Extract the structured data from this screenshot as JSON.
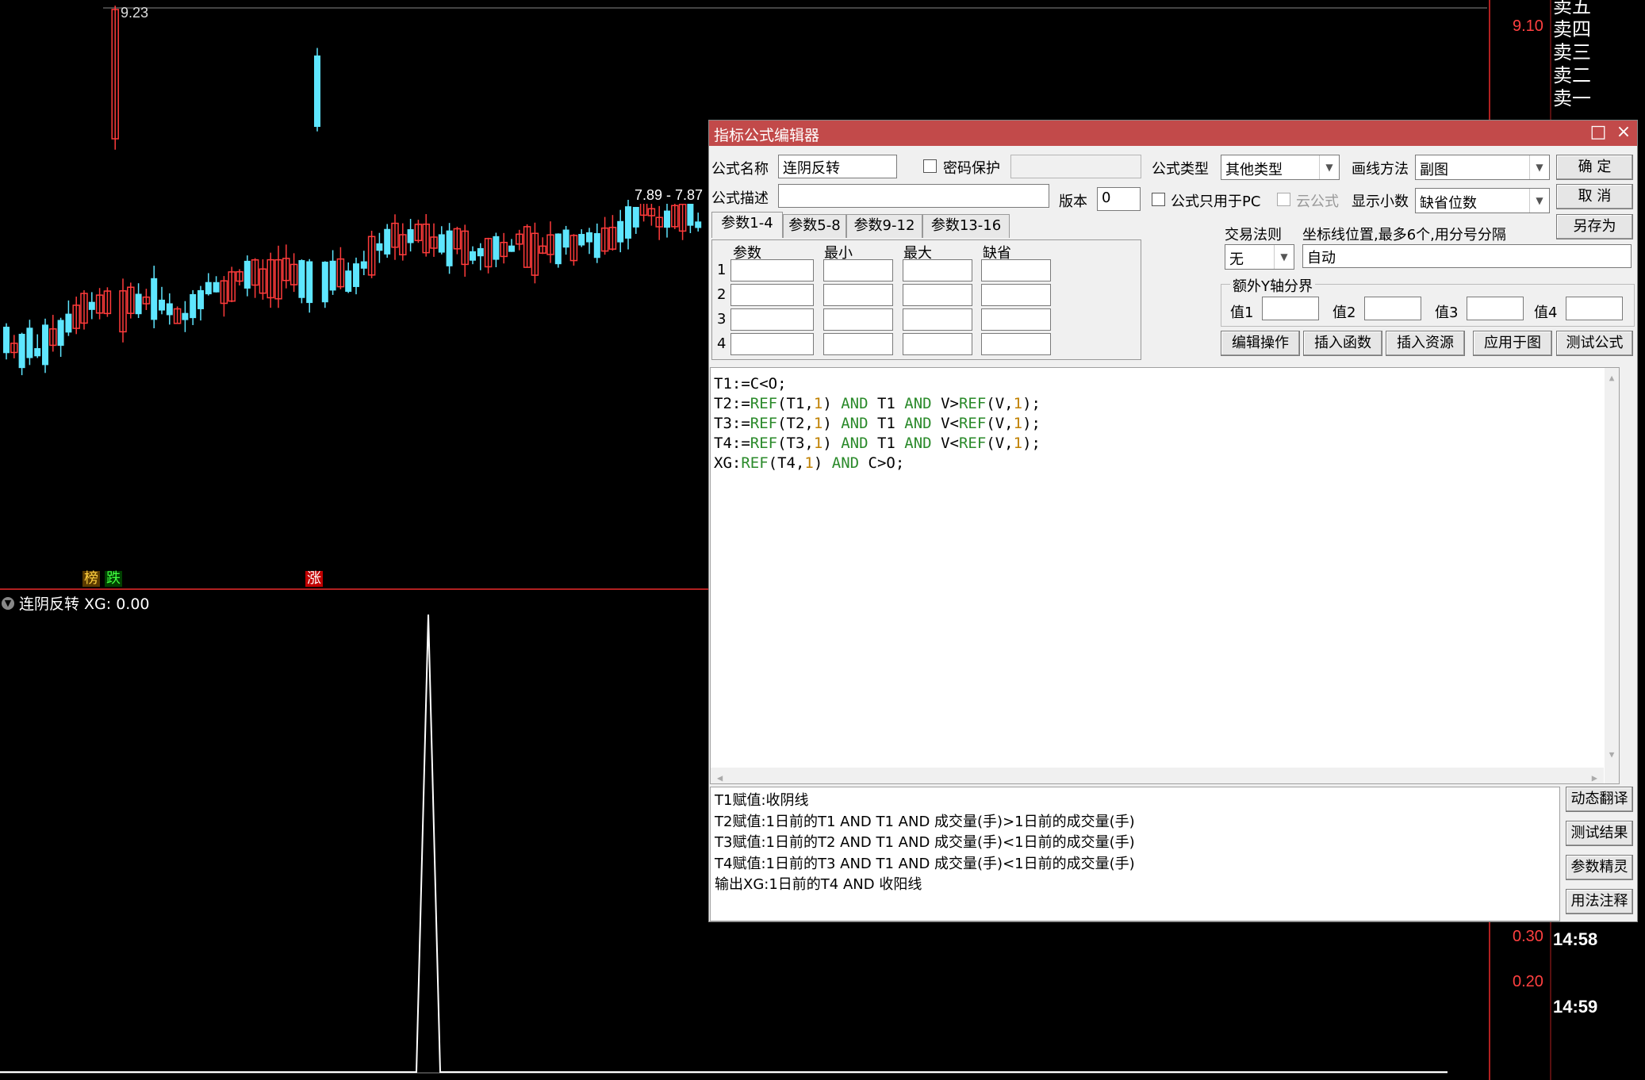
{
  "chart": {
    "high_label": "9.23",
    "crosshair_label": "7.89 - 7.87",
    "price_axis": [
      "9.10",
      "0.30",
      "0.20"
    ],
    "order_book": [
      "卖五",
      "卖四",
      "卖三",
      "卖二",
      "卖一"
    ],
    "times": [
      "14:58",
      "14:59"
    ],
    "tags": [
      {
        "text": "榜",
        "color": "#ffd040",
        "bg": "#5a3a00"
      },
      {
        "text": "跌",
        "color": "#40ff40",
        "bg": "#004000"
      },
      {
        "text": "涨",
        "color": "#ffffff",
        "bg": "#c00000"
      }
    ],
    "indicator_header": "连阴反转 XG: 0.00",
    "colors": {
      "up": "#ff3b3b",
      "down": "#5ee6ff",
      "indicator": "#ffffff"
    }
  },
  "dialog": {
    "title": "指标公式编辑器",
    "formula_name_label": "公式名称",
    "formula_name_value": "连阴反转",
    "password_label": "密码保护",
    "formula_type_label": "公式类型",
    "formula_type_value": "其他类型",
    "draw_method_label": "画线方法",
    "draw_method_value": "副图",
    "ok_button": "确 定",
    "cancel_button": "取 消",
    "saveas_button": "另存为",
    "desc_label": "公式描述",
    "desc_value": "",
    "version_label": "版本",
    "version_value": "0",
    "pc_only_label": "公式只用于PC",
    "cloud_label": "云公式",
    "decimals_label": "显示小数",
    "decimals_value": "缺省位数",
    "tabs": [
      "参数1-4",
      "参数5-8",
      "参数9-12",
      "参数13-16"
    ],
    "param_headers": [
      "参数",
      "最小",
      "最大",
      "缺省"
    ],
    "param_rows": [
      "1",
      "2",
      "3",
      "4"
    ],
    "trade_rule_label": "交易法则",
    "trade_rule_value": "无",
    "axis_label": "坐标线位置,最多6个,用分号分隔",
    "axis_value": "自动",
    "extra_y_label": "额外Y轴分界",
    "values": [
      "值1",
      "值2",
      "值3",
      "值4"
    ],
    "action_buttons": [
      "编辑操作",
      "插入函数",
      "插入资源",
      "应用于图",
      "测试公式"
    ],
    "side_buttons": [
      "动态翻译",
      "测试结果",
      "参数精灵",
      "用法注释"
    ],
    "explain_lines": [
      "T1赋值:收阴线",
      "T2赋值:1日前的T1 AND T1 AND 成交量(手)>1日前的成交量(手)",
      "T3赋值:1日前的T2 AND T1 AND 成交量(手)<1日前的成交量(手)",
      "T4赋值:1日前的T3 AND T1 AND 成交量(手)<1日前的成交量(手)",
      "输出XG:1日前的T4 AND 收阳线"
    ]
  },
  "code_lines": [
    [
      {
        "t": "T1:=C<O;",
        "c": "txt"
      }
    ],
    [
      {
        "t": "T2:=",
        "c": "txt"
      },
      {
        "t": "REF",
        "c": "kw"
      },
      {
        "t": "(T1,",
        "c": "txt"
      },
      {
        "t": "1",
        "c": "num"
      },
      {
        "t": ") ",
        "c": "txt"
      },
      {
        "t": "AND",
        "c": "kw"
      },
      {
        "t": " T1 ",
        "c": "txt"
      },
      {
        "t": "AND",
        "c": "kw"
      },
      {
        "t": " V>",
        "c": "txt"
      },
      {
        "t": "REF",
        "c": "kw"
      },
      {
        "t": "(V,",
        "c": "txt"
      },
      {
        "t": "1",
        "c": "num"
      },
      {
        "t": ");",
        "c": "txt"
      }
    ],
    [
      {
        "t": "T3:=",
        "c": "txt"
      },
      {
        "t": "REF",
        "c": "kw"
      },
      {
        "t": "(T2,",
        "c": "txt"
      },
      {
        "t": "1",
        "c": "num"
      },
      {
        "t": ") ",
        "c": "txt"
      },
      {
        "t": "AND",
        "c": "kw"
      },
      {
        "t": " T1 ",
        "c": "txt"
      },
      {
        "t": "AND",
        "c": "kw"
      },
      {
        "t": " V<",
        "c": "txt"
      },
      {
        "t": "REF",
        "c": "kw"
      },
      {
        "t": "(V,",
        "c": "txt"
      },
      {
        "t": "1",
        "c": "num"
      },
      {
        "t": ");",
        "c": "txt"
      }
    ],
    [
      {
        "t": "T4:=",
        "c": "txt"
      },
      {
        "t": "REF",
        "c": "kw"
      },
      {
        "t": "(T3,",
        "c": "txt"
      },
      {
        "t": "1",
        "c": "num"
      },
      {
        "t": ") ",
        "c": "txt"
      },
      {
        "t": "AND",
        "c": "kw"
      },
      {
        "t": " T1 ",
        "c": "txt"
      },
      {
        "t": "AND",
        "c": "kw"
      },
      {
        "t": " V<",
        "c": "txt"
      },
      {
        "t": "REF",
        "c": "kw"
      },
      {
        "t": "(V,",
        "c": "txt"
      },
      {
        "t": "1",
        "c": "num"
      },
      {
        "t": ");",
        "c": "txt"
      }
    ],
    [
      {
        "t": "XG:",
        "c": "txt"
      },
      {
        "t": "REF",
        "c": "kw"
      },
      {
        "t": "(T4,",
        "c": "txt"
      },
      {
        "t": "1",
        "c": "num"
      },
      {
        "t": ") ",
        "c": "txt"
      },
      {
        "t": "AND",
        "c": "kw"
      },
      {
        "t": " C>O;",
        "c": "txt"
      }
    ]
  ]
}
